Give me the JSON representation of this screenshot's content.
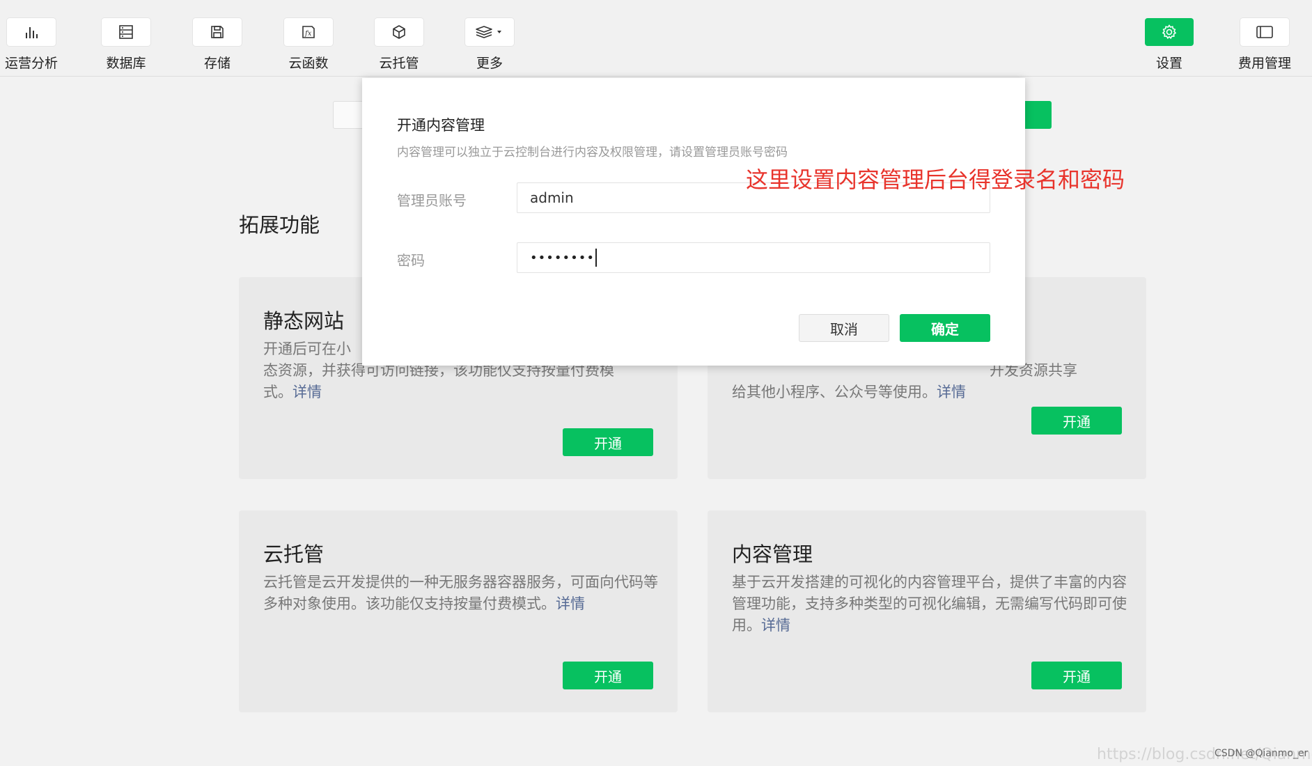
{
  "toolbar": {
    "items": [
      {
        "label": "运营分析",
        "icon": "bar-chart-icon"
      },
      {
        "label": "数据库",
        "icon": "database-icon"
      },
      {
        "label": "存储",
        "icon": "floppy-disk-icon"
      },
      {
        "label": "云函数",
        "icon": "function-icon"
      },
      {
        "label": "云托管",
        "icon": "cube-icon"
      },
      {
        "label": "更多",
        "icon": "layers-icon"
      },
      {
        "label": "设置",
        "icon": "gear-icon"
      },
      {
        "label": "费用管理",
        "icon": "billing-icon"
      }
    ],
    "accent_color": "#07c160"
  },
  "main": {
    "section_title": "拓展功能",
    "cards": [
      {
        "title": "静态网站",
        "desc": "开通后可在小",
        "desc_line2": "态资源，并获得可访问链接，该功能仅支持按量付费模",
        "desc_line3": "式。",
        "link": "详情",
        "button": "开通"
      },
      {
        "desc_line1": "开发资源共享",
        "desc_line2": "给其他小程序、公众号等使用。",
        "link": "详情",
        "button": "开通"
      },
      {
        "title": "云托管",
        "desc": "云托管是云开发提供的一种无服务器容器服务，可面向代码等多种对象使用。该功能仅支持按量付费模式。",
        "link": "详情",
        "button": "开通"
      },
      {
        "title": "内容管理",
        "desc": "基于云开发搭建的可视化的内容管理平台，提供了丰富的内容管理功能，支持多种类型的可视化编辑，无需编写代码即可使用。",
        "link": "详情",
        "button": "开通"
      }
    ]
  },
  "modal": {
    "title": "开通内容管理",
    "description": "内容管理可以独立于云控制台进行内容及权限管理，请设置管理员账号密码",
    "account_label": "管理员账号",
    "account_value": "admin",
    "password_label": "密码",
    "password_masked": "••••••••",
    "cancel_label": "取消",
    "ok_label": "确定"
  },
  "annotation": "这里设置内容管理后台得登录名和密码",
  "watermark": "https://blog.csdn.net/Qianmo_er",
  "credit": "CSDN @Qianmo_er"
}
